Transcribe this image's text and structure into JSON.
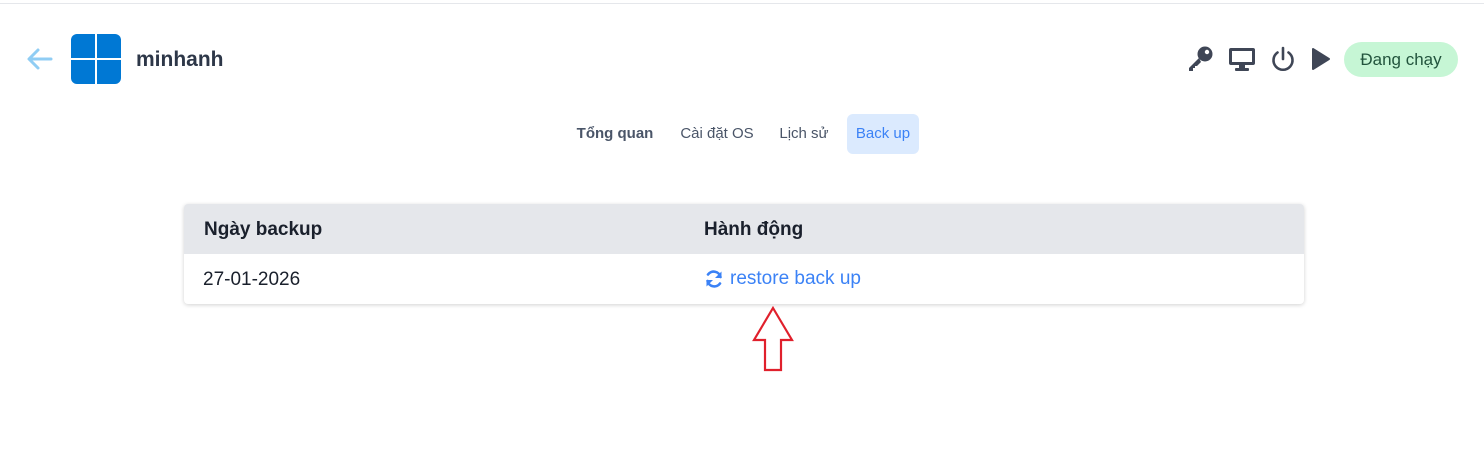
{
  "header": {
    "vm_name": "minhanh",
    "status_label": "Đang chạy",
    "icons": [
      "arrow-left-icon",
      "windows-logo",
      "key-icon",
      "monitor-icon",
      "power-icon",
      "play-icon"
    ]
  },
  "tabs": [
    {
      "label": "Tổng quan",
      "active": false
    },
    {
      "label": "Cài đặt OS",
      "active": false
    },
    {
      "label": "Lịch sử",
      "active": false
    },
    {
      "label": "Back up",
      "active": true
    }
  ],
  "table": {
    "columns": [
      "Ngày backup",
      "Hành động"
    ],
    "rows": [
      {
        "date": "27-01-2026",
        "action": "restore back up"
      }
    ]
  },
  "colors": {
    "accent": "#3b82f6",
    "status_bg": "#c6f6d5",
    "status_text": "#22543d",
    "windows_blue": "#0078d4",
    "annotation_red": "#e0202c"
  }
}
